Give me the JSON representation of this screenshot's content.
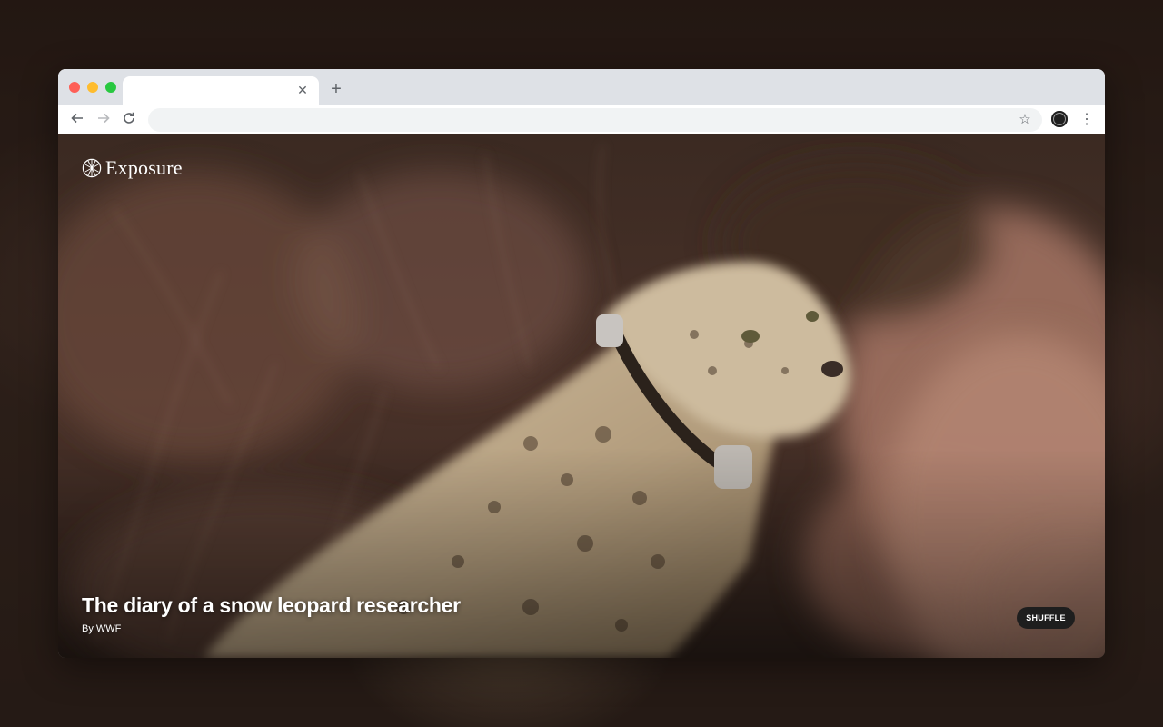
{
  "browser": {
    "tab": {
      "title": "",
      "close_icon": "close-icon"
    },
    "new_tab_icon": "plus-icon",
    "toolbar": {
      "back_icon": "arrow-left-icon",
      "forward_icon": "arrow-right-icon",
      "reload_icon": "reload-icon",
      "address": "",
      "bookmark_icon": "star-icon",
      "extension_icon": "exposure-extension-icon",
      "menu_icon": "kebab-menu-icon"
    }
  },
  "page": {
    "logo": "Exposure",
    "story": {
      "title": "The diary of a snow leopard researcher",
      "author": "By WWF"
    },
    "shuffle_label": "SHUFFLE"
  }
}
